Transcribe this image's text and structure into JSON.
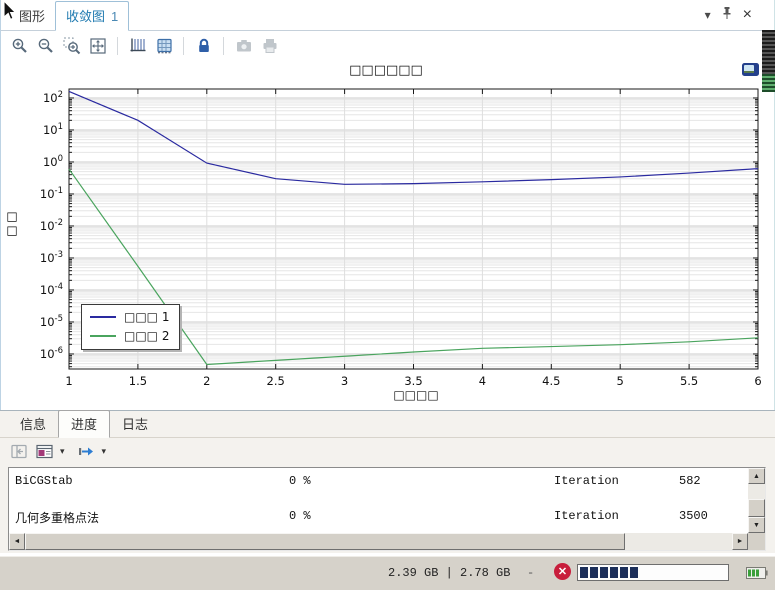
{
  "window": {
    "tabs": [
      {
        "label": "图形"
      },
      {
        "label": "收敛图",
        "number": "1"
      }
    ],
    "controls": {
      "dropdown": "▾",
      "close": "×"
    }
  },
  "toolbar": {
    "icons": [
      "zoom-in",
      "zoom-out",
      "zoom-selection",
      "zoom-extents",
      "axes",
      "grid",
      "lock",
      "snapshot",
      "print"
    ]
  },
  "chart_data": {
    "type": "line",
    "title": "□□□□□□",
    "xlabel": "□□□□",
    "ylabel": "□□",
    "grid": true,
    "legend_position": "lower-left",
    "xlim": [
      1,
      6
    ],
    "xtick_step": 0.5,
    "ylim_exp": [
      -6.47,
      2.28
    ],
    "yticks_exp": [
      2,
      1,
      0,
      -1,
      -2,
      -3,
      -4,
      -5,
      -6
    ],
    "x": [
      1,
      1.5,
      2,
      2.5,
      3,
      3.5,
      4,
      4.5,
      5,
      5.5,
      6
    ],
    "series": [
      {
        "name": "□□□ 1",
        "color": "#2a2aa0",
        "values": [
          160,
          20,
          0.92,
          0.3,
          0.2,
          0.21,
          0.24,
          0.28,
          0.34,
          0.45,
          0.62
        ]
      },
      {
        "name": "□□□ 2",
        "color": "#4aa45e",
        "values": [
          0.6,
          0.00055,
          4.7e-07,
          6.3e-07,
          8.5e-07,
          1.15e-06,
          1.5e-06,
          1.7e-06,
          1.95e-06,
          2.4e-06,
          3.2e-06
        ]
      }
    ]
  },
  "progress_panel": {
    "tabs": [
      {
        "label": "信息"
      },
      {
        "label": "进度"
      },
      {
        "label": "日志"
      }
    ],
    "rows": [
      {
        "name": "BiCGStab",
        "percent": "0 %",
        "counter": "Iteration",
        "value": "582"
      },
      {
        "name": "几何多重格点法",
        "percent": "0 %",
        "counter": "Iteration",
        "value": "3500"
      }
    ]
  },
  "statusbar": {
    "memory": "2.39 GB | 2.78 GB",
    "dash": "-",
    "progress_filled": 6,
    "progress_total": 15
  }
}
